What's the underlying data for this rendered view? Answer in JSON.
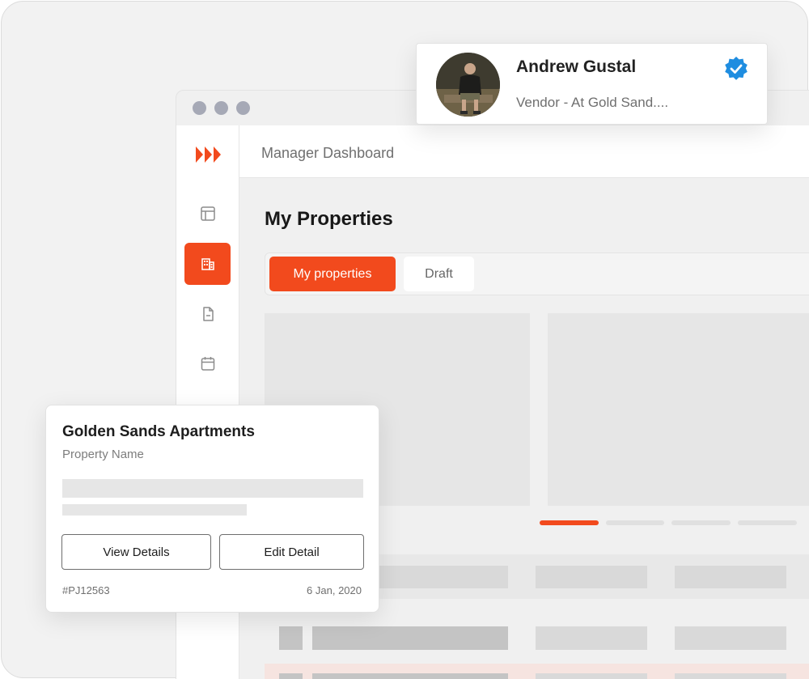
{
  "brand": {
    "accent": "#f24a1d",
    "verified_color": "#1f8de0"
  },
  "header": {
    "title": "Manager Dashboard"
  },
  "sidebar": {
    "items": [
      {
        "icon": "layout-icon",
        "active": false
      },
      {
        "icon": "building-icon",
        "active": true
      },
      {
        "icon": "document-icon",
        "active": false
      },
      {
        "icon": "calendar-icon",
        "active": false
      }
    ]
  },
  "main": {
    "title": "My Properties",
    "tabs": [
      {
        "label": "My properties",
        "active": true
      },
      {
        "label": "Draft",
        "active": false
      }
    ]
  },
  "property_card": {
    "name": "Golden Sands Apartments",
    "subtitle": "Property Name",
    "view_label": "View Details",
    "edit_label": "Edit Detail",
    "code": "#PJ12563",
    "date": "6 Jan, 2020"
  },
  "user": {
    "name": "Andrew Gustal",
    "role": "Vendor - At Gold Sand....",
    "verified": true
  }
}
